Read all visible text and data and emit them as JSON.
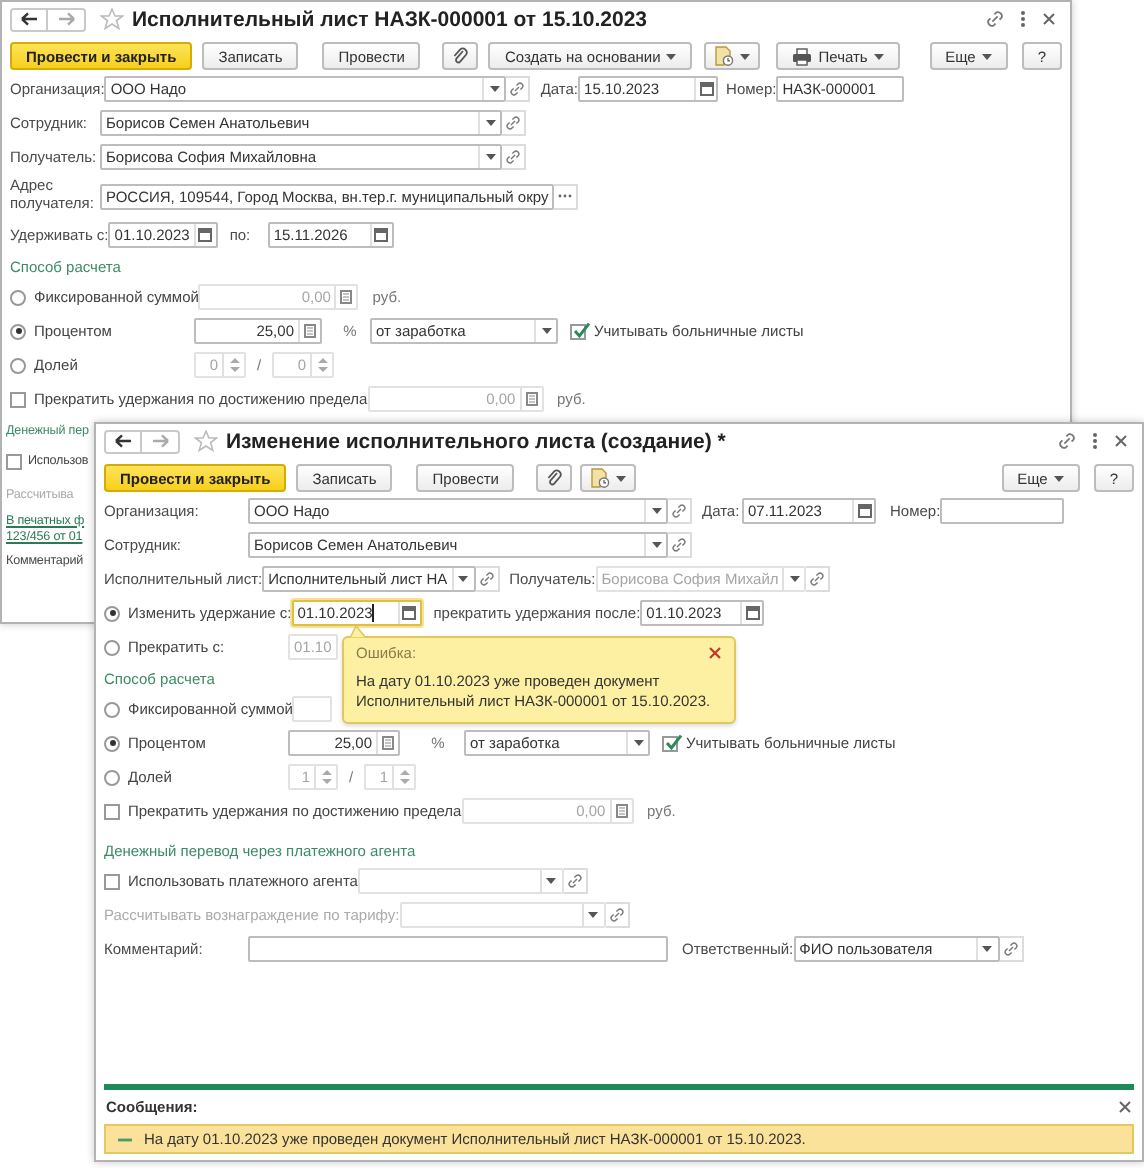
{
  "windows": [
    {
      "title": "Исполнительный лист НАЗК-000001 от 15.10.2023",
      "toolbar": [
        {
          "kind": "primary",
          "label": "Провести и закрыть"
        },
        {
          "kind": "button",
          "label": "Записать"
        },
        {
          "kind": "button",
          "label": "Провести"
        },
        {
          "kind": "attach"
        },
        {
          "kind": "menu",
          "label": "Создать на основании"
        },
        {
          "kind": "reports"
        },
        {
          "kind": "print",
          "label": "Печать"
        }
      ],
      "toolbar_right": [
        {
          "kind": "menu",
          "label": "Еще"
        },
        {
          "kind": "button",
          "label": "?"
        }
      ],
      "rows": [
        {
          "items": [
            {
              "kind": "label",
              "text": "Организация:",
              "disabled": false
            },
            {
              "kind": "select",
              "value": "ООО Надо",
              "disabled": false
            },
            {
              "kind": "label",
              "text": "Дата:",
              "disabled": false
            },
            {
              "kind": "date",
              "value": "15.10.2023",
              "disabled": false
            },
            {
              "kind": "label",
              "text": "Номер:",
              "disabled": false
            },
            {
              "kind": "text",
              "value": "НАЗК-000001",
              "disabled": false
            }
          ]
        },
        {
          "items": [
            {
              "kind": "label",
              "text": "Сотрудник:",
              "disabled": false
            },
            {
              "kind": "select",
              "value": "Борисов Семен Анатольевич",
              "disabled": false
            }
          ]
        },
        {
          "items": [
            {
              "kind": "label",
              "text": "Получатель:",
              "disabled": false
            },
            {
              "kind": "select",
              "value": "Борисова София Михайловна",
              "disabled": false
            }
          ]
        },
        {
          "items": [
            {
              "kind": "label",
              "text": "Адрес получателя:",
              "disabled": false
            },
            {
              "kind": "choice",
              "value": "РОССИЯ, 109544, Город Москва, вн.тер.г. муниципальный окру",
              "disabled": false
            }
          ]
        },
        {
          "items": [
            {
              "kind": "label",
              "text": "Удерживать с:",
              "disabled": false
            },
            {
              "kind": "date",
              "value": "01.10.2023",
              "disabled": false
            },
            {
              "kind": "label",
              "text": "по:",
              "disabled": false
            },
            {
              "kind": "date",
              "value": "15.11.2026",
              "disabled": false
            }
          ]
        },
        {
          "items": [
            {
              "kind": "section",
              "text": "Способ расчета"
            }
          ]
        },
        {
          "items": [
            {
              "kind": "radio",
              "text": "Фиксированной суммой",
              "selected": false
            },
            {
              "kind": "number",
              "value": "0,00",
              "disabled": true
            },
            {
              "kind": "unit",
              "text": "руб."
            }
          ]
        },
        {
          "items": [
            {
              "kind": "radio",
              "text": "Процентом",
              "selected": true
            },
            {
              "kind": "number",
              "value": "25,00",
              "disabled": false
            },
            {
              "kind": "unit",
              "text": "%"
            },
            {
              "kind": "dropdown",
              "value": "от заработка",
              "disabled": false
            },
            {
              "kind": "checkbox",
              "text": "Учитывать больничные листы",
              "checked": true
            }
          ]
        },
        {
          "items": [
            {
              "kind": "radio",
              "text": "Долей",
              "selected": false
            },
            {
              "kind": "spin",
              "value": "0",
              "disabled": true
            },
            {
              "kind": "unit",
              "text": "/"
            },
            {
              "kind": "spin",
              "value": "0",
              "disabled": true
            }
          ]
        },
        {
          "items": [
            {
              "kind": "checkbox",
              "text": "Прекратить удержания по достижению предела",
              "checked": false
            },
            {
              "kind": "number",
              "value": "0,00",
              "disabled": true
            },
            {
              "kind": "unit",
              "text": "руб."
            }
          ]
        },
        {
          "items": [
            {
              "kind": "section",
              "text": "Денежный пер"
            }
          ]
        },
        {
          "items": [
            {
              "kind": "checkbox",
              "text": "Использов",
              "checked": false
            }
          ]
        },
        {
          "items": [
            {
              "kind": "label",
              "text": "Рассчитыва",
              "disabled": true
            }
          ]
        },
        {
          "items": [
            {
              "kind": "link",
              "text": "В печатных ф"
            }
          ]
        },
        {
          "items": [
            {
              "kind": "link",
              "text": "123/456 от 01"
            }
          ]
        },
        {
          "items": [
            {
              "kind": "label",
              "text": "Комментарий",
              "disabled": false
            }
          ]
        }
      ]
    },
    {
      "title": "Изменение исполнительного листа (создание) *",
      "toolbar": [
        {
          "kind": "primary",
          "label": "Провести и закрыть"
        },
        {
          "kind": "button",
          "label": "Записать"
        },
        {
          "kind": "button",
          "label": "Провести"
        },
        {
          "kind": "attach"
        },
        {
          "kind": "reports"
        }
      ],
      "toolbar_right": [
        {
          "kind": "menu",
          "label": "Еще"
        },
        {
          "kind": "button",
          "label": "?"
        }
      ],
      "rows": [
        {
          "items": [
            {
              "kind": "label",
              "text": "Организация:",
              "disabled": false
            },
            {
              "kind": "select",
              "value": "ООО Надо",
              "disabled": false
            },
            {
              "kind": "label",
              "text": "Дата:",
              "disabled": false
            },
            {
              "kind": "date",
              "value": "07.11.2023",
              "disabled": false
            },
            {
              "kind": "label",
              "text": "Номер:",
              "disabled": false
            },
            {
              "kind": "text",
              "disabled": false
            }
          ]
        },
        {
          "items": [
            {
              "kind": "label",
              "text": "Сотрудник:",
              "disabled": false
            },
            {
              "kind": "select",
              "value": "Борисов Семен Анатольевич",
              "disabled": false
            }
          ]
        },
        {
          "items": [
            {
              "kind": "label",
              "text": "Исполнительный лист:",
              "disabled": false
            },
            {
              "kind": "select",
              "value": "Исполнительный лист НА",
              "disabled": false
            },
            {
              "kind": "label",
              "text": "Получатель:",
              "disabled": false
            },
            {
              "kind": "select",
              "value": "Борисова София Михайл",
              "disabled": true
            }
          ]
        },
        {
          "items": [
            {
              "kind": "radio",
              "text": "Изменить удержание с:",
              "selected": true
            },
            {
              "kind": "date",
              "value": "01.10.2023",
              "disabled": false,
              "focused": true
            },
            {
              "kind": "label",
              "text": "прекратить удержания после:",
              "disabled": false
            },
            {
              "kind": "date",
              "value": "01.10.2023",
              "disabled": false
            }
          ]
        },
        {
          "items": [
            {
              "kind": "radio",
              "text": "Прекратить с:",
              "selected": false
            },
            {
              "kind": "date",
              "value": "01.10",
              "disabled": true
            }
          ]
        },
        {
          "items": [
            {
              "kind": "section",
              "text": "Способ расчета"
            }
          ]
        },
        {
          "items": [
            {
              "kind": "radio",
              "text": "Фиксированной суммой",
              "selected": false
            },
            {
              "kind": "number",
              "disabled": true
            }
          ]
        },
        {
          "items": [
            {
              "kind": "radio",
              "text": "Процентом",
              "selected": true
            },
            {
              "kind": "number",
              "value": "25,00",
              "disabled": false
            },
            {
              "kind": "unit",
              "text": "%"
            },
            {
              "kind": "dropdown",
              "value": "от заработка",
              "disabled": false
            },
            {
              "kind": "checkbox",
              "text": "Учитывать больничные листы",
              "checked": true
            }
          ]
        },
        {
          "items": [
            {
              "kind": "radio",
              "text": "Долей",
              "selected": false
            },
            {
              "kind": "spin",
              "value": "1",
              "disabled": true
            },
            {
              "kind": "unit",
              "text": "/"
            },
            {
              "kind": "spin",
              "value": "1",
              "disabled": true
            }
          ]
        },
        {
          "items": [
            {
              "kind": "checkbox",
              "text": "Прекратить удержания по достижению предела",
              "checked": false
            },
            {
              "kind": "number",
              "value": "0,00",
              "disabled": true
            },
            {
              "kind": "unit",
              "text": "руб."
            }
          ]
        },
        {
          "items": [
            {
              "kind": "section",
              "text": "Денежный перевод через платежного агента"
            }
          ]
        },
        {
          "items": [
            {
              "kind": "checkbox",
              "text": "Использовать платежного агента",
              "checked": false
            },
            {
              "kind": "select",
              "disabled": true
            }
          ]
        },
        {
          "items": [
            {
              "kind": "label",
              "text": "Рассчитывать вознаграждение по тарифу:",
              "disabled": true
            },
            {
              "kind": "select",
              "disabled": true
            }
          ]
        },
        {
          "items": [
            {
              "kind": "label",
              "text": "Комментарий:",
              "disabled": false
            },
            {
              "kind": "text",
              "disabled": false
            },
            {
              "kind": "label",
              "text": "Ответственный:",
              "disabled": false
            },
            {
              "kind": "select",
              "value": "ФИО пользователя",
              "disabled": false
            }
          ]
        }
      ],
      "tooltip": {
        "title": "Ошибка:",
        "text": "На дату 01.10.2023 уже проведен документ Исполнительный лист НАЗК-000001 от 15.10.2023."
      },
      "messages": {
        "title": "Сообщения:",
        "items": [
          {
            "text": "На дату 01.10.2023 уже проведен документ Исполнительный лист НАЗК-000001 от 15.10.2023."
          }
        ]
      }
    }
  ]
}
